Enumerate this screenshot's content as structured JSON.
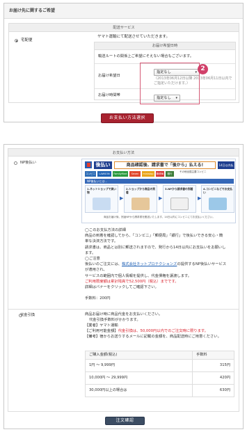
{
  "delivery": {
    "header_title": "お届け先に関するご希望",
    "section_title": "配送サービス",
    "option_label": "宅配便",
    "note": "ヤマト運輸にて配送させていただきます。",
    "inner_title": "お届け希望日時",
    "inner_note": "輸送ルートの関係上ご希望にそえない場合もございます。",
    "date_label": "お届け希望日",
    "date_value": "指定なし",
    "date_hint": "（2013年06月12日以降 2013年06月11日以内で ご指定いただけます。）",
    "time_label": "お届け時間帯",
    "time_value": "指定なし",
    "badge": "2",
    "accent_color": "#a8222f",
    "badge_color": "#d1416a"
  },
  "proceed_button": "お支払い方法選択",
  "payment": {
    "section_title": "お支払い方法",
    "np": {
      "label": "NP後払い",
      "banner": {
        "brand": "後払い",
        "headline": "商品確認後、請求書で「後から」払える!",
        "badge_14": "14日以内払い",
        "stores": [
          "コンビニ",
          "LAWSON",
          "FamilyMart",
          "Seven",
          "ministop",
          "郵便局",
          "銀行"
        ],
        "stores_right": "その他全国主要コンビニ",
        "steps_title": "NP後払いとは…",
        "steps": [
          "1.ネットショップで買い物",
          "2.ショップから商品の到着",
          "3.NPから請求書の到着",
          "4.コンビニなどでお支払い"
        ],
        "footnote": "商品お届け後、別途NPから請求書を郵送いたします。14日以内にコンビニにてお支払いください。"
      },
      "lines": [
        "◯このお支払方法の詳細",
        "商品の到着を確認してから、「コンビニ」「郵便局」「銀行」で後払いできる安心・簡",
        "単な決済方法です。",
        "請求書は、商品とは別に郵送されますので、発行から14日以内にお支払いをお願いし",
        "ます。",
        "◯ご注意",
        "後払いのご注文には、",
        "の提供するNP後払いサービス",
        "が適用され、",
        "サービスの範囲内で個人情報を提供し、代金債権を譲渡します。",
        "ご利用限度額は累計残高で52,500円（税込）までです。",
        "詳細はバナーをクリックしてご確認下さい。",
        "手数料：200円"
      ],
      "link": "株式会社ネットプロテクションズ"
    },
    "cod": {
      "label": "代金引換",
      "lines": [
        "商品お届け時に商品代金をお支払いください。",
        "代金引換手数料がかかります。",
        "【業者】ヤマト運輸",
        "【ご利用可能金額】",
        "代金引換は、50,000円以内でのご注文時に限ります。",
        "【備考】宿からお送りするメールに記載の金額を、商品配送時にご用意ください。"
      ],
      "table": {
        "headers": [
          "ご購入金額(税込)",
          "手数料"
        ],
        "rows": [
          [
            "1円 ～ 9,999円",
            "315円"
          ],
          [
            "10,000円 ～ 29,999円",
            "420円"
          ],
          [
            "30,000円以上の場合は",
            "630円"
          ]
        ]
      }
    }
  },
  "confirm_button": "注文確認"
}
